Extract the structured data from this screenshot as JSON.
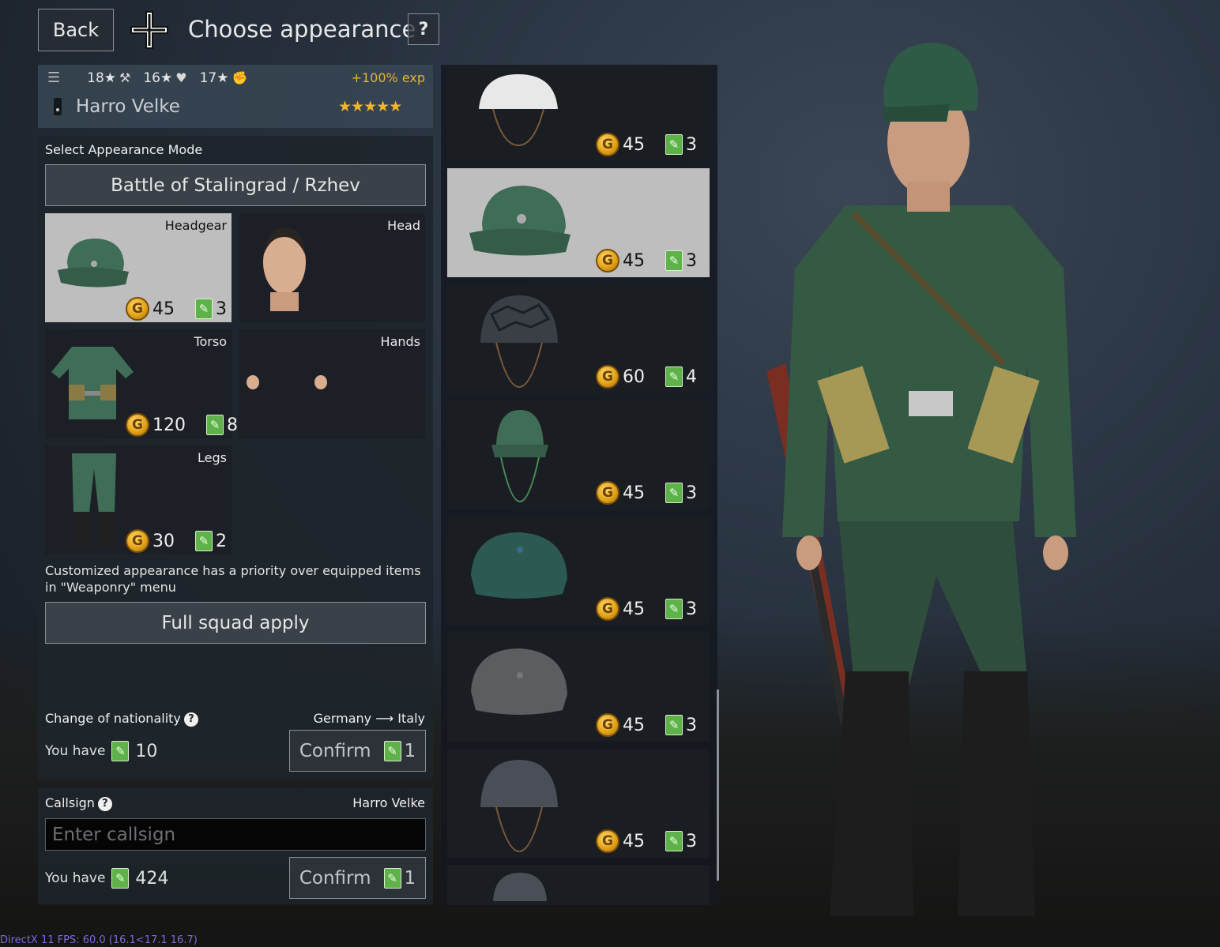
{
  "header": {
    "back_label": "Back",
    "title": "Choose appearance",
    "help_label": "?"
  },
  "soldier": {
    "stats": [
      "18★",
      "16★",
      "17★"
    ],
    "stat_icons": [
      "kit-icon",
      "health-icon",
      "fist-icon"
    ],
    "exp_bonus": "+100% exp",
    "name": "Harro Velke",
    "stars": "★★★★★"
  },
  "appearance": {
    "mode_label": "Select Appearance Mode",
    "mode_value": "Battle of Stalingrad / Rzhev",
    "slots": [
      {
        "label": "Headgear",
        "price": "45",
        "tickets": "3",
        "selected": true
      },
      {
        "label": "Head",
        "price": "",
        "tickets": "",
        "selected": false
      },
      {
        "label": "Torso",
        "price": "120",
        "tickets": "8",
        "selected": false
      },
      {
        "label": "Hands",
        "price": "",
        "tickets": "",
        "selected": false
      },
      {
        "label": "Legs",
        "price": "30",
        "tickets": "2",
        "selected": false
      }
    ],
    "info_text": "Customized appearance has a priority over equipped items in \"Weaponry\" menu",
    "full_squad_label": "Full squad apply"
  },
  "nationality": {
    "label": "Change of nationality",
    "from": "Germany",
    "arrow": "⟶",
    "to": "Italy",
    "you_have_label": "You have",
    "you_have_value": "10",
    "confirm_label": "Confirm",
    "confirm_cost": "1"
  },
  "callsign": {
    "label": "Callsign",
    "current": "Harro Velke",
    "placeholder": "Enter callsign",
    "you_have_label": "You have",
    "you_have_value": "424",
    "confirm_label": "Confirm",
    "confirm_cost": "1"
  },
  "items": [
    {
      "name": "white-helmet-cover",
      "price": "45",
      "tickets": "3"
    },
    {
      "name": "field-cap-green",
      "price": "45",
      "tickets": "3",
      "selected": true
    },
    {
      "name": "camo-net-helmet",
      "price": "60",
      "tickets": "4"
    },
    {
      "name": "cap-with-bandana",
      "price": "45",
      "tickets": "3"
    },
    {
      "name": "winter-cap-teal",
      "price": "45",
      "tickets": "3"
    },
    {
      "name": "winter-cap-grey",
      "price": "45",
      "tickets": "3"
    },
    {
      "name": "steel-helmet",
      "price": "45",
      "tickets": "3"
    }
  ],
  "coin_glyph": "G",
  "ticket_glyph": "✎",
  "colors": {
    "accent_gold": "#e2b43a",
    "ticket_green": "#5fb14a",
    "selected_bg": "#bebebe"
  },
  "fps": "DirectX 11 FPS: 60.0 (16.1<17.1 16.7)"
}
